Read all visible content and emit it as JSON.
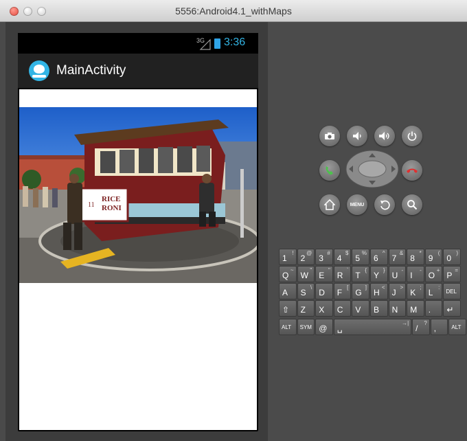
{
  "window": {
    "title": "5556:Android4.1_withMaps"
  },
  "status_bar": {
    "network": "3G",
    "time": "3:36"
  },
  "action_bar": {
    "title": "MainActivity"
  },
  "photo": {
    "sign_line1": "RICE",
    "sign_line2": "RONI",
    "car_number": "11"
  },
  "hardware_buttons": [
    {
      "name": "camera-icon"
    },
    {
      "name": "volume-down-icon"
    },
    {
      "name": "volume-up-icon"
    },
    {
      "name": "power-icon"
    },
    {
      "name": "call-icon"
    },
    {
      "name": "end-call-icon"
    },
    {
      "name": "home-icon"
    },
    {
      "name": "menu-button",
      "label": "MENU"
    },
    {
      "name": "back-icon"
    },
    {
      "name": "search-icon"
    }
  ],
  "keyboard": {
    "row1": [
      {
        "k": "1",
        "s": "!"
      },
      {
        "k": "2",
        "s": "@"
      },
      {
        "k": "3",
        "s": "#"
      },
      {
        "k": "4",
        "s": "$"
      },
      {
        "k": "5",
        "s": "%"
      },
      {
        "k": "6",
        "s": "^"
      },
      {
        "k": "7",
        "s": "&"
      },
      {
        "k": "8",
        "s": "*"
      },
      {
        "k": "9",
        "s": "("
      },
      {
        "k": "0",
        "s": ")"
      }
    ],
    "row2": [
      {
        "k": "Q",
        "s": "~"
      },
      {
        "k": "W",
        "s": "\""
      },
      {
        "k": "E",
        "s": "\""
      },
      {
        "k": "R",
        "s": "`"
      },
      {
        "k": "T",
        "s": "{"
      },
      {
        "k": "Y",
        "s": "}"
      },
      {
        "k": "U",
        "s": "-"
      },
      {
        "k": "I",
        "s": "-"
      },
      {
        "k": "O",
        "s": "+"
      },
      {
        "k": "P",
        "s": "="
      }
    ],
    "row3": [
      {
        "k": "A",
        "s": ""
      },
      {
        "k": "S",
        "s": "\\"
      },
      {
        "k": "D",
        "s": ""
      },
      {
        "k": "F",
        "s": "["
      },
      {
        "k": "G",
        "s": "]"
      },
      {
        "k": "H",
        "s": "<"
      },
      {
        "k": "J",
        "s": ">"
      },
      {
        "k": "K",
        "s": ";"
      },
      {
        "k": "L",
        "s": ":"
      },
      {
        "k": "DEL",
        "s": ""
      }
    ],
    "row4": [
      {
        "k": "⇧",
        "s": ""
      },
      {
        "k": "Z",
        "s": ""
      },
      {
        "k": "X",
        "s": ""
      },
      {
        "k": "C",
        "s": ""
      },
      {
        "k": "V",
        "s": ""
      },
      {
        "k": "B",
        "s": ""
      },
      {
        "k": "N",
        "s": ""
      },
      {
        "k": "M",
        "s": ""
      },
      {
        "k": ".",
        "s": ""
      },
      {
        "k": "↵",
        "s": ""
      }
    ],
    "row5": [
      {
        "k": "ALT",
        "s": ""
      },
      {
        "k": "SYM",
        "s": ""
      },
      {
        "k": "@",
        "s": ""
      },
      {
        "k": "␣",
        "s": "→|"
      },
      {
        "k": "/",
        "s": "?"
      },
      {
        "k": ",",
        "s": ""
      },
      {
        "k": "ALT",
        "s": ""
      }
    ]
  },
  "colors": {
    "accent": "#33b5e5",
    "action_bar": "#212121",
    "emulator_body": "#4b4b4b"
  }
}
